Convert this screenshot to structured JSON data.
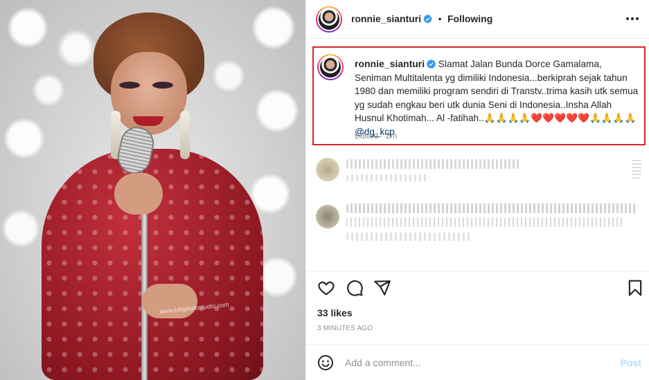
{
  "post": {
    "username": "ronnie_sianturi",
    "follow_status": "Following",
    "separator": "•",
    "photo_watermark": "www.kikiphotostudio.com"
  },
  "caption": {
    "username": "ronnie_sianturi",
    "text": "Slamat Jalan Bunda Dorce Gamalama, Seniman Multitalenta yg dimiliki Indonesia...berkiprah sejak tahun 1980 dan memiliki program sendiri di Transtv..trima kasih utk semua yg sudah engkau beri utk dunia Seni di Indonesia..Insha Allah Husnul Khotimah... Al -fatihah..🙏🙏🙏🙏❤️❤️❤️❤️❤️🙏🙏🙏🙏",
    "mention": "@dg_kcp",
    "meta": "Edited · 2m"
  },
  "engagement": {
    "likes": "33 likes",
    "time": "3 MINUTES AGO"
  },
  "comment": {
    "placeholder": "Add a comment...",
    "post_label": "Post"
  },
  "colors": {
    "highlight_border": "#d0262e",
    "verified": "#3897f0",
    "link": "#00376b",
    "post_disabled": "#b2dffc"
  },
  "icons": {
    "verified": "verified-badge-icon",
    "more": "more-options-icon",
    "like": "heart-icon",
    "comment": "comment-icon",
    "share": "paper-plane-icon",
    "save": "bookmark-icon",
    "emoji": "emoji-icon"
  }
}
